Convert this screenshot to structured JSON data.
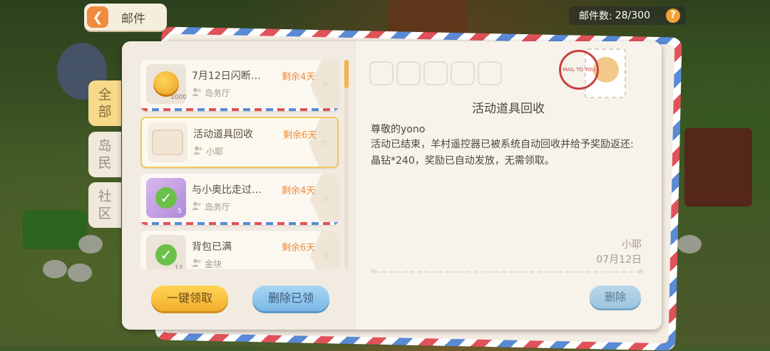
{
  "header": {
    "back_label": "邮件",
    "mail_count_label": "邮件数:",
    "mail_count_value": "28/300",
    "help_symbol": "?"
  },
  "tabs": [
    {
      "label": "全部",
      "active": true
    },
    {
      "label": "岛民",
      "active": false
    },
    {
      "label": "社区",
      "active": false
    }
  ],
  "mails": [
    {
      "title": "7月12日闪断…",
      "remaining": "剩余4天",
      "sender": "岛务厅",
      "thumb": "coin-icon",
      "qty": "10000"
    },
    {
      "title": "活动道具回收",
      "remaining": "剩余6天",
      "sender": "小耶",
      "thumb": "box-icon",
      "qty": ""
    },
    {
      "title": "与小奥比走过…",
      "remaining": "剩余4天",
      "sender": "岛务厅",
      "thumb": "checked-gift-icon",
      "qty": "5"
    },
    {
      "title": "背包已满",
      "remaining": "剩余6天",
      "sender": "金块",
      "thumb": "checked-item-icon",
      "qty": "12"
    }
  ],
  "buttons": {
    "claim_all": "一键领取",
    "delete_read": "删除已领",
    "delete": "删除"
  },
  "detail": {
    "title": "活动道具回收",
    "greeting": "尊敬的yono",
    "body": "活动已结束，羊村遥控器已被系统自动回收并给予奖励返还:晶钻*240，奖励已自动发放，无需领取。",
    "signature": "小耶",
    "date": "07月12日",
    "postmark_text": "MAIL TO YOU"
  },
  "colors": {
    "accent_orange": "#ee8a3a",
    "tab_active": "#f7d98a",
    "claim_yellow": "#f3b02c",
    "delete_blue": "#7bb8e6"
  }
}
